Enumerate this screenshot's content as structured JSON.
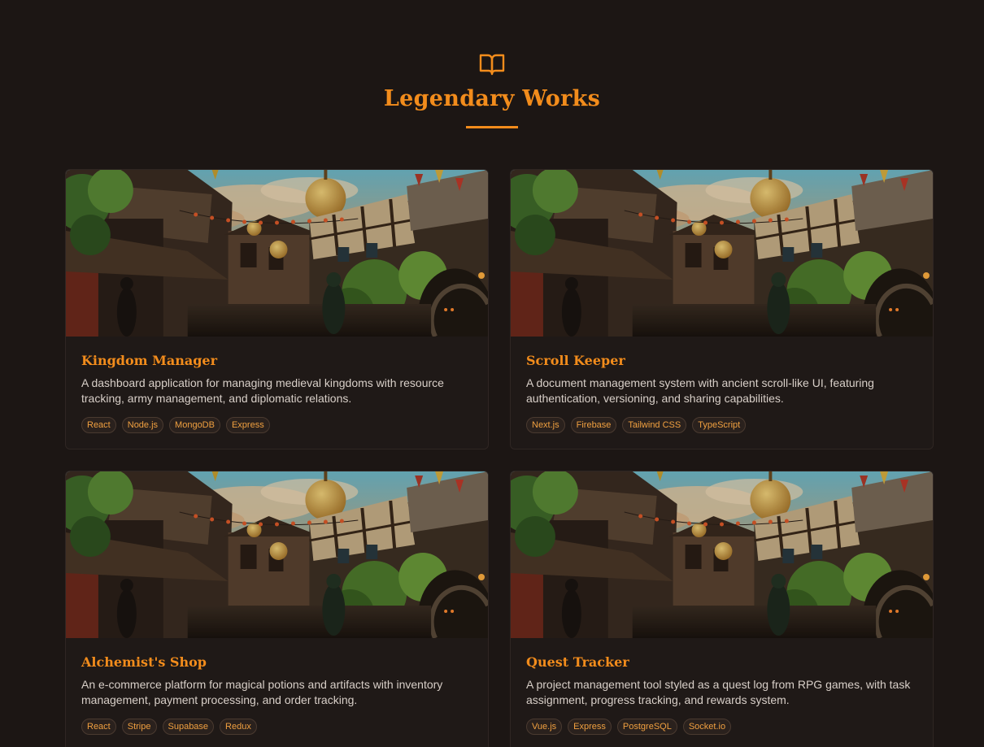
{
  "header": {
    "icon": "book-open-icon",
    "title": "Legendary Works"
  },
  "colors": {
    "accent": "#f28c1c",
    "background": "#1c1614",
    "card": "#1f1917"
  },
  "projects": [
    {
      "title": "Kingdom Manager",
      "description": "A dashboard application for managing medieval kingdoms with resource tracking, army management, and diplomatic relations.",
      "tags": [
        "React",
        "Node.js",
        "MongoDB",
        "Express"
      ]
    },
    {
      "title": "Scroll Keeper",
      "description": "A document management system with ancient scroll-like UI, featuring authentication, versioning, and sharing capabilities.",
      "tags": [
        "Next.js",
        "Firebase",
        "Tailwind CSS",
        "TypeScript"
      ]
    },
    {
      "title": "Alchemist's Shop",
      "description": "An e-commerce platform for magical potions and artifacts with inventory management, payment processing, and order tracking.",
      "tags": [
        "React",
        "Stripe",
        "Supabase",
        "Redux"
      ]
    },
    {
      "title": "Quest Tracker",
      "description": "A project management tool styled as a quest log from RPG games, with task assignment, progress tracking, and rewards system.",
      "tags": [
        "Vue.js",
        "Express",
        "PostgreSQL",
        "Socket.io"
      ]
    }
  ]
}
